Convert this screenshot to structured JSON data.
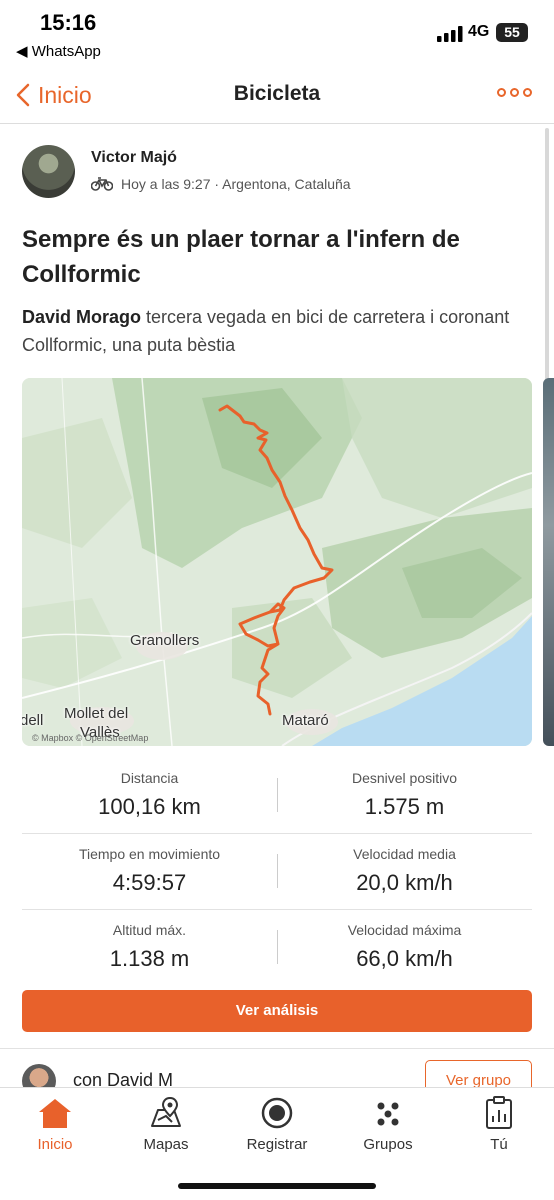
{
  "status_bar": {
    "time": "15:16",
    "back_app": "◀ WhatsApp",
    "network": "4G",
    "battery": "55"
  },
  "nav": {
    "back_label": "Inicio",
    "title": "Bicicleta"
  },
  "activity": {
    "author": "Victor Majó",
    "meta": "Hoy a las 9:27 · Argentona, Cataluña",
    "title": "Sempre és un plaer tornar a l'infern de Collformic",
    "desc_mention": "David Morago",
    "desc_rest": " tercera vegada en bici de carretera i coronant Collformic, una puta bèstia"
  },
  "map": {
    "labels": {
      "granollers": "Granollers",
      "mollet": "Mollet del",
      "valles": "Vallès",
      "mataro": "Mataró",
      "dell": "dell"
    },
    "credit": "© Mapbox © OpenStreetMap"
  },
  "stats": [
    {
      "label": "Distancia",
      "value": "100,16 km"
    },
    {
      "label": "Desnivel positivo",
      "value": "1.575 m"
    },
    {
      "label": "Tiempo en movimiento",
      "value": "4:59:57"
    },
    {
      "label": "Velocidad media",
      "value": "20,0 km/h"
    },
    {
      "label": "Altitud máx.",
      "value": "1.138 m"
    },
    {
      "label": "Velocidad máxima",
      "value": "66,0 km/h"
    }
  ],
  "buttons": {
    "analysis": "Ver análisis",
    "group": "Ver grupo"
  },
  "with_text": "con David M",
  "tabs": [
    {
      "label": "Inicio",
      "icon": "home-icon",
      "active": true
    },
    {
      "label": "Mapas",
      "icon": "map-icon",
      "active": false
    },
    {
      "label": "Registrar",
      "icon": "record-icon",
      "active": false
    },
    {
      "label": "Grupos",
      "icon": "groups-icon",
      "active": false
    },
    {
      "label": "Tú",
      "icon": "profile-icon",
      "active": false
    }
  ],
  "colors": {
    "accent": "#e8612b",
    "route": "#e8612b",
    "sea": "#b9dcf2"
  }
}
